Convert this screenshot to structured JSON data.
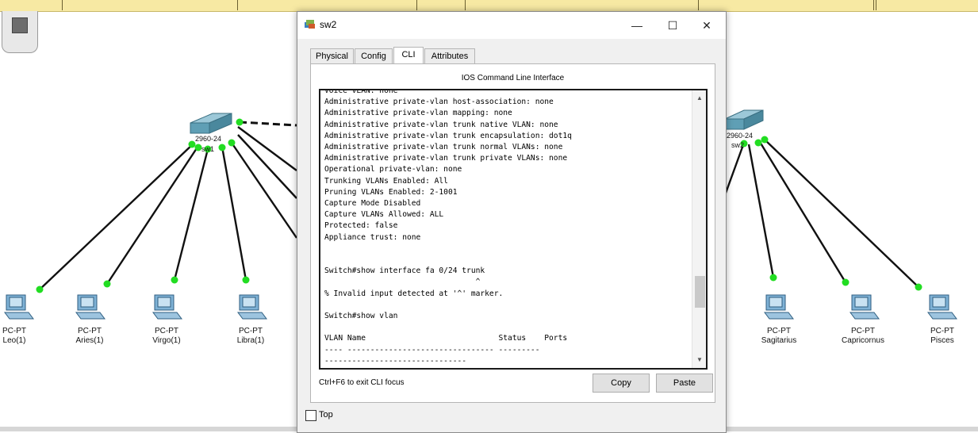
{
  "dialog": {
    "title": "sw2",
    "buttons": {
      "minimize": "—",
      "maximize": "☐",
      "close": "✕"
    },
    "tabs": [
      {
        "label": "Physical",
        "active": false
      },
      {
        "label": "Config",
        "active": false
      },
      {
        "label": "CLI",
        "active": true
      },
      {
        "label": "Attributes",
        "active": false
      }
    ],
    "cli_heading": "IOS Command Line Interface",
    "terminal_lines": [
      "Voice VLAN: none",
      "Administrative private-vlan host-association: none",
      "Administrative private-vlan mapping: none",
      "Administrative private-vlan trunk native VLAN: none",
      "Administrative private-vlan trunk encapsulation: dot1q",
      "Administrative private-vlan trunk normal VLANs: none",
      "Administrative private-vlan trunk private VLANs: none",
      "Operational private-vlan: none",
      "Trunking VLANs Enabled: All",
      "Pruning VLANs Enabled: 2-1001",
      "Capture Mode Disabled",
      "Capture VLANs Allowed: ALL",
      "Protected: false",
      "Appliance trust: none",
      "",
      "",
      "Switch#show interface fa 0/24 trunk",
      "                                 ^",
      "% Invalid input detected at '^' marker.",
      "",
      "Switch#show vlan",
      "",
      "VLAN Name                             Status    Ports",
      "---- -------------------------------- ---------",
      "-------------------------------"
    ],
    "hint": "Ctrl+F6 to exit CLI focus",
    "copy_label": "Copy",
    "paste_label": "Paste",
    "top_label": "Top",
    "top_checked": false
  },
  "topology": {
    "switches": [
      {
        "label": "sw1",
        "model": "2960-24"
      },
      {
        "label": "sw2",
        "model": "2960-24"
      }
    ],
    "pcs": [
      {
        "type": "PC-PT",
        "name": "Leo(1)"
      },
      {
        "type": "PC-PT",
        "name": "Aries(1)"
      },
      {
        "type": "PC-PT",
        "name": "Virgo(1)"
      },
      {
        "type": "PC-PT",
        "name": "Libra(1)"
      },
      {
        "type": "PC-PT",
        "name": "Sagitarius"
      },
      {
        "type": "PC-PT",
        "name": "Capricornus"
      },
      {
        "type": "PC-PT",
        "name": "Pisces"
      }
    ],
    "colors": {
      "link": "#111111",
      "link_up": "#22dd22",
      "switch": "#5f9fb5"
    }
  }
}
